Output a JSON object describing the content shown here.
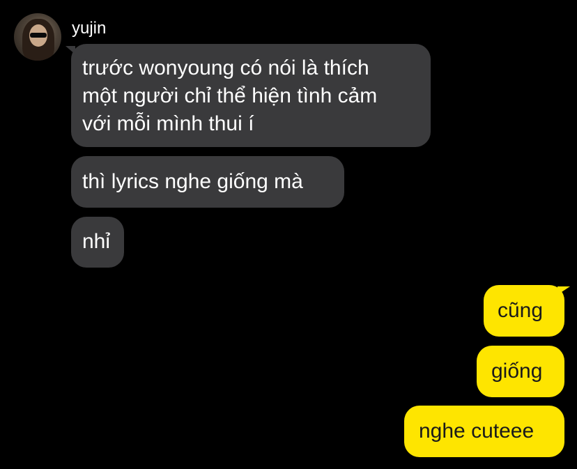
{
  "chat": {
    "sender": {
      "name": "yujin",
      "avatar": "profile-photo"
    },
    "incoming": [
      {
        "lines": [
          "trước wonyoung có nói là thích",
          "một người chỉ thể hiện tình cảm",
          "với mỗi mình thui í"
        ]
      },
      {
        "lines": [
          "thì lyrics nghe giống mà"
        ]
      },
      {
        "lines": [
          "nhỉ"
        ]
      }
    ],
    "outgoing": [
      {
        "text": "cũng"
      },
      {
        "text": "giống"
      },
      {
        "text": "nghe cuteee"
      }
    ]
  },
  "colors": {
    "background": "#000000",
    "incoming_bubble": "#3a3a3c",
    "outgoing_bubble": "#fee500",
    "incoming_text": "#ffffff",
    "outgoing_text": "#1a1a1a"
  }
}
